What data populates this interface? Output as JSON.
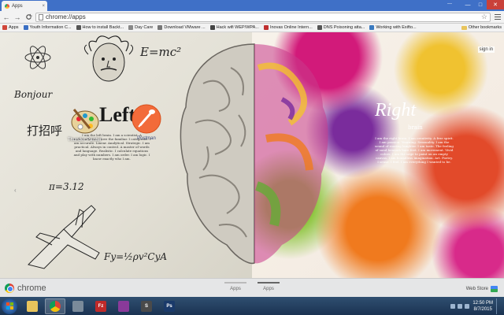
{
  "browser": {
    "tab_title": "Apps",
    "tab_close": "×",
    "user_label": "—",
    "window_controls": [
      "—",
      "□",
      "✕"
    ],
    "back": "←",
    "forward": "→",
    "reload": "C",
    "home": "⌂",
    "url": "chrome://apps",
    "star": "☆",
    "bookmarks": [
      {
        "label": "Apps",
        "color": "#d0463b"
      },
      {
        "label": "Youth Information C...",
        "color": "#3a6fc4"
      },
      {
        "label": "How to install Backt...",
        "color": "#555555"
      },
      {
        "label": "Day Care",
        "color": "#888888"
      },
      {
        "label": "Download VMware ...",
        "color": "#777777"
      },
      {
        "label": "Hack wifi WEP/WPA...",
        "color": "#444444"
      },
      {
        "label": "Inovas Online Intern...",
        "color": "#c03030"
      },
      {
        "label": "DNS Poisoning atta...",
        "color": "#555555"
      },
      {
        "label": "Working with Exifto...",
        "color": "#3a7ac0"
      }
    ],
    "other_bookmarks": "Other bookmarks"
  },
  "apps_page": {
    "sign_in": "sign in",
    "art": {
      "emc2": "E=mc²",
      "bonjour": "Bonjour",
      "chinese": "打招呼",
      "pi": "π=3.12",
      "formula": "Fy=ρ/2 v²C<sub>y</sub>A",
      "formula_text": "Fy=½ρv²CyA",
      "left_word": "Left",
      "left_word_hidden": "L",
      "left_para": "I am the left brain. I am a scientist. A mathematician. I love the familiar. I categorize. I am accurate. Linear. Analytical. Strategic. I am practical. Always in control. A master of words and language. Realistic. I calculate equations and play with numbers. I am order. I am logic. I know exactly who I am.",
      "right_word": "Right",
      "right_sub": "brain",
      "right_para": "I am the right brain. I am creativity. A free spirit. I am passion. Yearning. Sensuality. I am the sound of roaring laughter. I am taste. The feeling of sand beneath bare feet. I am movement. Vivid colors. I am the urge to paint on an empty canvas. I am boundless imagination. Art. Poetry. I sense. I feel. I am everything I wanted to be."
    },
    "apps": [
      {
        "name": "Thunder Painter"
      },
      {
        "name": "Postman"
      }
    ],
    "prev_arrow": "‹",
    "footer": {
      "brand": "chrome",
      "tabs": [
        "Apps",
        "Apps"
      ],
      "webstore": "Web Store"
    }
  },
  "taskbar": {
    "time": "12:50 PM",
    "date": "8/7/2015",
    "items": [
      {
        "name": "explorer",
        "color": "#e8c45c"
      },
      {
        "name": "chrome",
        "color": "#db4437"
      },
      {
        "name": "calculator",
        "color": "#7a8a9a"
      },
      {
        "name": "filezilla",
        "color": "#bf2a2a",
        "glyph": "Fz"
      },
      {
        "name": "winrar",
        "color": "#8a3a9a"
      },
      {
        "name": "sublime",
        "color": "#4a4a4a",
        "glyph": "S"
      },
      {
        "name": "photoshop",
        "color": "#1a3a6a",
        "glyph": "Ps"
      }
    ]
  }
}
